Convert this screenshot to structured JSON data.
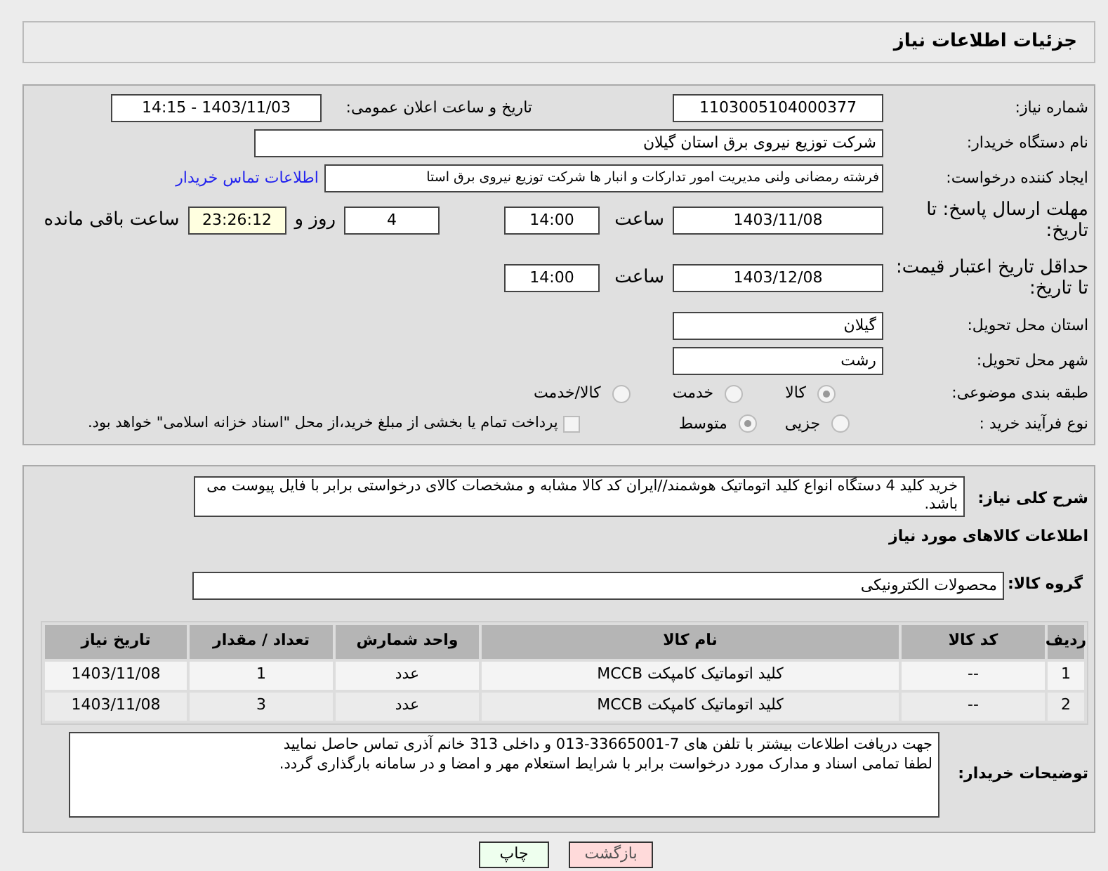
{
  "header": {
    "title": "جزئیات اطلاعات نیاز"
  },
  "need_number": {
    "label": "شماره نیاز:",
    "value": "1103005104000377"
  },
  "announce": {
    "label": "تاریخ و ساعت اعلان عمومی:",
    "value": "1403/11/03 - 14:15"
  },
  "buyer_org": {
    "label": "نام دستگاه خریدار:",
    "value": "شرکت توزیع نیروی برق استان گیلان"
  },
  "creator": {
    "label": "ایجاد کننده درخواست:",
    "value": "فرشته رمضانی ولنی مدیریت امور تدارکات و انبار ها شرکت توزیع نیروی برق استا",
    "link": "اطلاعات تماس خریدار"
  },
  "reply_deadline": {
    "label": "مهلت ارسال پاسخ: تا تاریخ:",
    "date": "1403/11/08",
    "time_label": "ساعت",
    "time": "14:00",
    "days": "4",
    "days_label": "روز و",
    "remaining": "23:26:12",
    "remaining_label": "ساعت باقی مانده"
  },
  "price_validity": {
    "label": "حداقل تاریخ اعتبار قیمت: تا تاریخ:",
    "date": "1403/12/08",
    "time_label": "ساعت",
    "time": "14:00"
  },
  "province": {
    "label": "استان محل تحویل:",
    "value": "گیلان"
  },
  "city": {
    "label": "شهر محل تحویل:",
    "value": "رشت"
  },
  "category": {
    "label": "طبقه بندی موضوعی:",
    "options": [
      {
        "label": "کالا",
        "selected": true
      },
      {
        "label": "خدمت",
        "selected": false
      },
      {
        "label": "کالا/خدمت",
        "selected": false
      }
    ]
  },
  "purchase_type": {
    "label": "نوع فرآیند خرید :",
    "options": [
      {
        "label": "جزیی",
        "selected": false
      },
      {
        "label": "متوسط",
        "selected": true
      }
    ],
    "treasury": {
      "label": "پرداخت تمام یا بخشی از مبلغ خرید،از محل \"اسناد خزانه اسلامی\" خواهد بود.",
      "checked": false
    }
  },
  "description": {
    "label": "شرح کلی نیاز:",
    "value": "خرید کلید 4 دستگاه انواع کلید اتوماتیک هوشمند//ایران کد کالا مشابه و مشخصات کالای درخواستی برابر با فایل پیوست می باشد."
  },
  "goods_title": "اطلاعات کالاهای مورد نیاز",
  "goods_group": {
    "label": "گروه کالا:",
    "value": "محصولات الکترونیکی"
  },
  "table": {
    "columns": [
      "ردیف",
      "کد کالا",
      "نام کالا",
      "واحد شمارش",
      "تعداد / مقدار",
      "تاریخ نیاز"
    ],
    "rows": [
      [
        "1",
        "--",
        "کلید اتوماتیک کامپکت MCCB",
        "عدد",
        "1",
        "1403/11/08"
      ],
      [
        "2",
        "--",
        "کلید اتوماتیک کامپکت MCCB",
        "عدد",
        "3",
        "1403/11/08"
      ]
    ]
  },
  "buyer_notes": {
    "label": "توضیحات خریدار:",
    "lines": [
      "جهت دریافت اطلاعات بیشتر با تلفن های 7-33665001-013 و داخلی 313 خانم آذری تماس حاصل نمایید",
      "لطفا تمامی اسناد و مدارک مورد درخواست برابر با شرایط استعلام مهر و امضا و در سامانه بارگذاری گردد."
    ]
  },
  "buttons": [
    {
      "label": "بازگشت",
      "kind": "back"
    },
    {
      "label": "چاپ",
      "kind": "print"
    }
  ]
}
